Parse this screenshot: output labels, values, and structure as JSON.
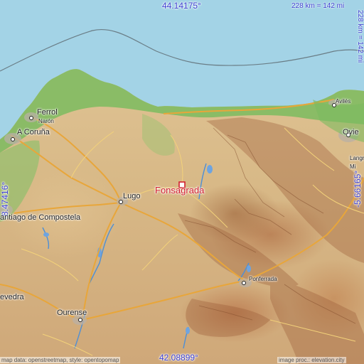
{
  "coordinates": {
    "top_lat": "44.14175°",
    "bottom_lat": "42.08899°",
    "left_lon": "-8.47416°",
    "right_lon": "-5.66165°"
  },
  "scale": {
    "horizontal": "228 km = 142 mi",
    "vertical": "228 km = 142 mi"
  },
  "target": {
    "name": "Fonsagrada"
  },
  "cities": {
    "ferrol": "Ferrol",
    "naron": "Narón",
    "a_coruna": "A Coruña",
    "lugo": "Lugo",
    "santiago": "antiago de Compostela",
    "pontevedra": "evedra",
    "ourense": "Ourense",
    "ponferrada": "Ponferrada",
    "aviles": "Avilés",
    "oviedo": "Ovie",
    "langreo": "Langr",
    "mieres": "Mi"
  },
  "credits": {
    "left": "map data: openstreetmap, style: opentopomap",
    "right": "image proc.: elevation.city"
  },
  "colors": {
    "sea": "#a3d3e6",
    "land": "#dcbf8e",
    "vegetation": "#5fae4c",
    "road": "#f0c35a",
    "target_marker": "#d21f2f",
    "coordinate_text": "#3c3fd0"
  },
  "icons": {
    "target_marker": "red-square-marker-icon",
    "city_marker": "city-dot-icon"
  }
}
